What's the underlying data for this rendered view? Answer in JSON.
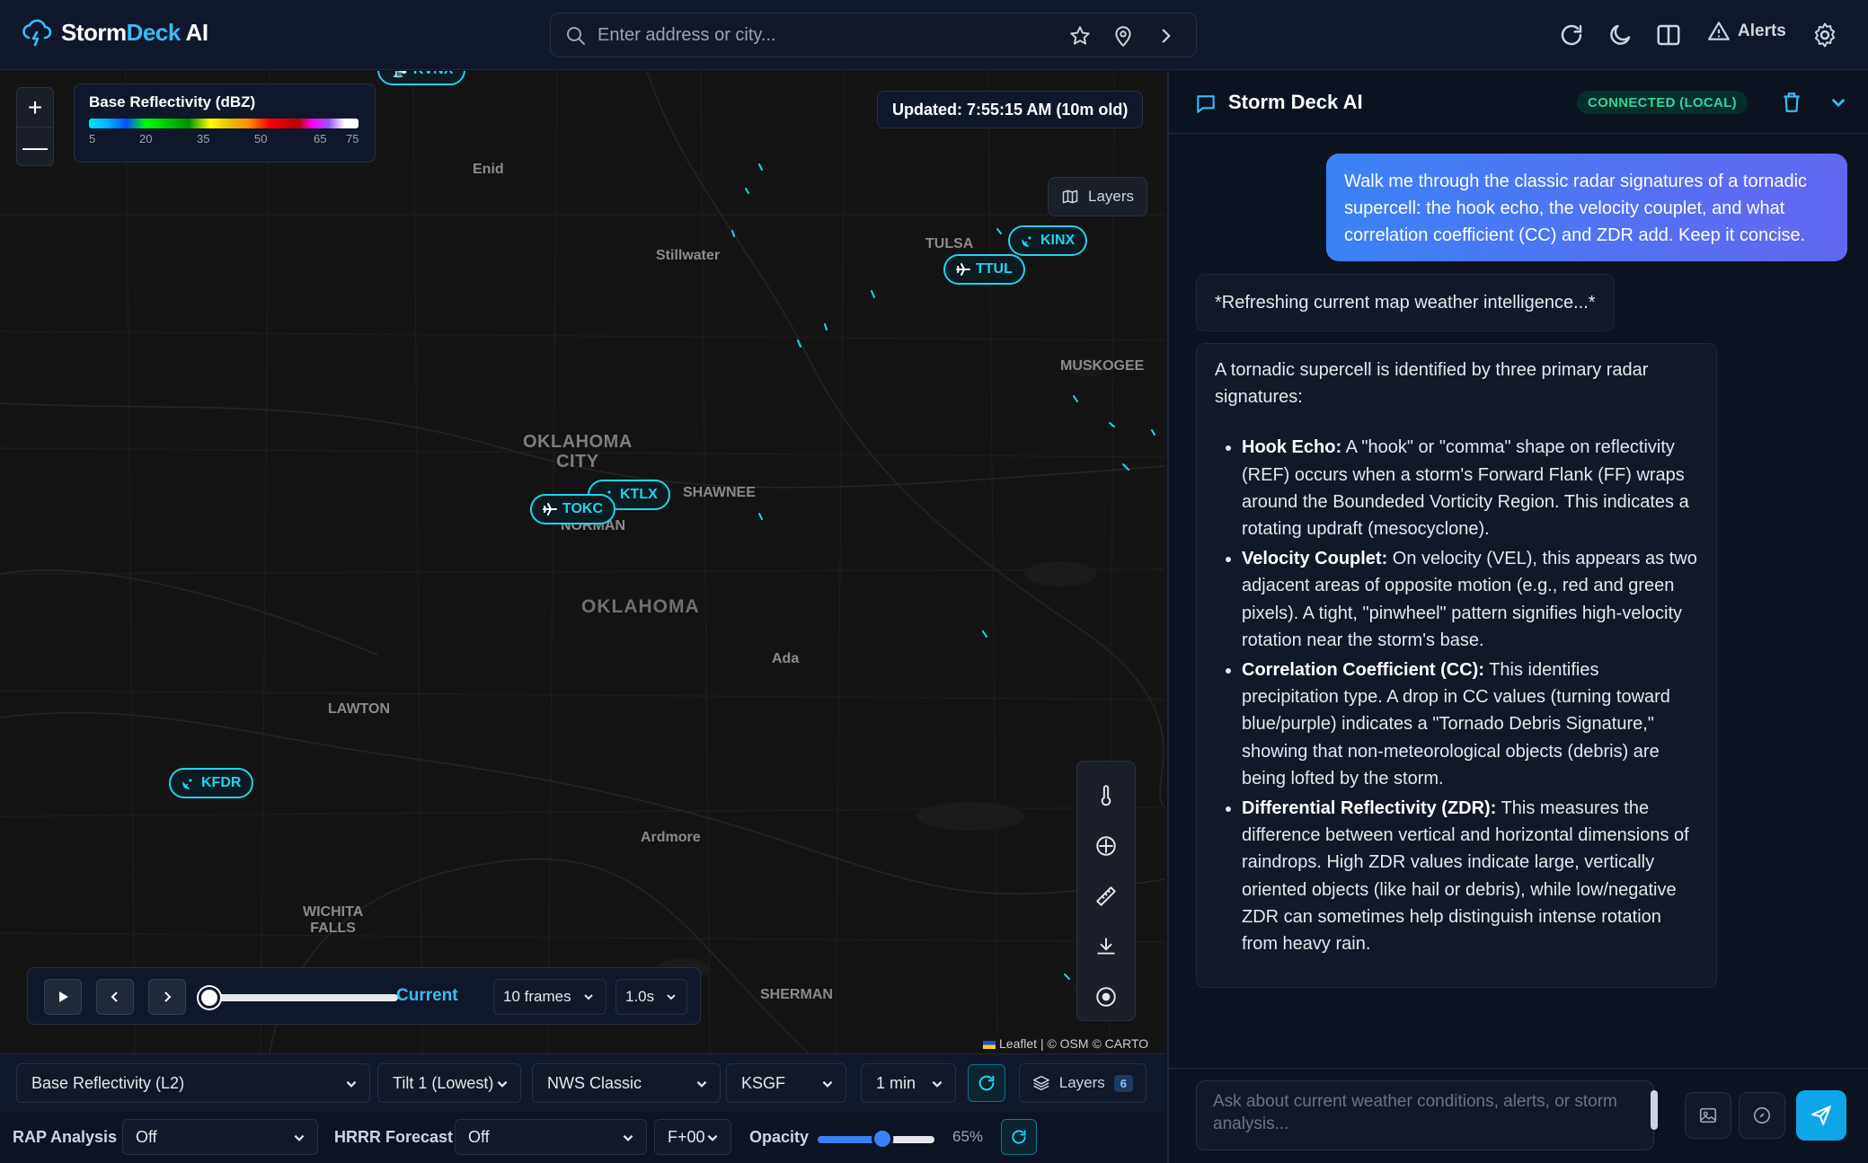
{
  "app": {
    "brand_prefix": "Storm",
    "brand_accent": "Deck",
    "brand_suffix": " AI",
    "accent_color": "#38bdf8"
  },
  "search": {
    "placeholder": "Enter address or city..."
  },
  "header": {
    "alerts_label": "Alerts"
  },
  "map": {
    "legend": {
      "title": "Base Reflectivity (dBZ)",
      "ticks": [
        "5",
        "20",
        "35",
        "50",
        "65",
        "75"
      ]
    },
    "updated": "Updated: 7:55:15 AM (10m old)",
    "layers_label": "Layers",
    "places": {
      "enid": "Enid",
      "stillwater": "Stillwater",
      "tulsa": "TULSA",
      "muskogee": "MUSKOGEE",
      "okc_line1": "OKLAHOMA",
      "okc_line2": "CITY",
      "shawnee": "SHAWNEE",
      "norman": "NORMAN",
      "oklahoma": "OKLAHOMA",
      "ada": "Ada",
      "lawton": "LAWTON",
      "ardmore": "Ardmore",
      "wichita_line1": "WICHITA",
      "wichita_line2": "FALLS",
      "sherman": "SHERMAN"
    },
    "stations": {
      "kinx": "KINX",
      "ttul": "TTUL",
      "ktlx": "KTLX",
      "tokc": "TOKC",
      "kfdr": "KFDR",
      "kvnx": "KVNX"
    },
    "attribution": {
      "leaflet": "Leaflet",
      "osm": "| © OSM © CARTO"
    }
  },
  "player": {
    "current_label": "Current",
    "frames": "10 frames",
    "speed": "1.0s"
  },
  "controls": {
    "product": "Base Reflectivity (L2)",
    "tilt": "Tilt 1 (Lowest)",
    "palette": "NWS Classic",
    "station": "KSGF",
    "interval": "1 min",
    "layers_label": "Layers",
    "layers_count": "6",
    "rap_label": "RAP Analysis",
    "rap_value": "Off",
    "hrrr_label": "HRRR Forecast",
    "hrrr_value": "Off",
    "forecast_hour": "F+00",
    "opacity_label": "Opacity",
    "opacity_value": "65%",
    "opacity_fraction": 0.65
  },
  "chat": {
    "title": "Storm Deck AI",
    "status": "CONNECTED (LOCAL)",
    "status_color": "#34d399",
    "user_message": "Walk me through the classic radar signatures of a tornadic supercell: the hook echo, the velocity couplet, and what correlation coefficient (CC) and ZDR add. Keep it concise.",
    "refresh_message": "*Refreshing current map weather intelligence...*",
    "answer_intro": "A tornadic supercell is identified by three primary radar signatures:",
    "answer_items": [
      {
        "term": "Hook Echo:",
        "text": " A \"hook\" or \"comma\" shape on reflectivity (REF) occurs when a storm's Forward Flank (FF) wraps around the Boundeded Vorticity Region. This indicates a rotating updraft (mesocyclone)."
      },
      {
        "term": "Velocity Couplet:",
        "text": " On velocity (VEL), this appears as two adjacent areas of opposite motion (e.g., red and green pixels). A tight, \"pinwheel\" pattern signifies high-velocity rotation near the storm's base."
      },
      {
        "term": "Correlation Coefficient (CC):",
        "text": " This identifies precipitation type. A drop in CC values (turning toward blue/purple) indicates a \"Tornado Debris Signature,\" showing that non-meteorological objects (debris) are being lofted by the storm."
      },
      {
        "term": "Differential Reflectivity (ZDR):",
        "text": " This measures the difference between vertical and horizontal dimensions of raindrops. High ZDR values indicate large, vertically oriented objects (like hail or debris), while low/negative ZDR can sometimes help distinguish intense rotation from heavy rain."
      }
    ],
    "input_placeholder": "Ask about current weather conditions, alerts, or storm analysis..."
  }
}
